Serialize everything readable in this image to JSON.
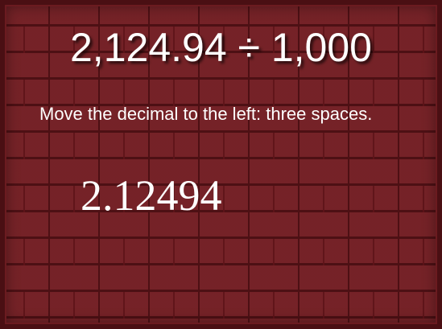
{
  "slide": {
    "title": "2,124.94 ÷ 1,000",
    "instruction": "Move the decimal to the left: three spaces.",
    "answer": "2.12494"
  },
  "colors": {
    "background": "#8f2a30",
    "mortar": "#5e1419",
    "frame": "#4a0f13",
    "text": "#ffffff"
  }
}
